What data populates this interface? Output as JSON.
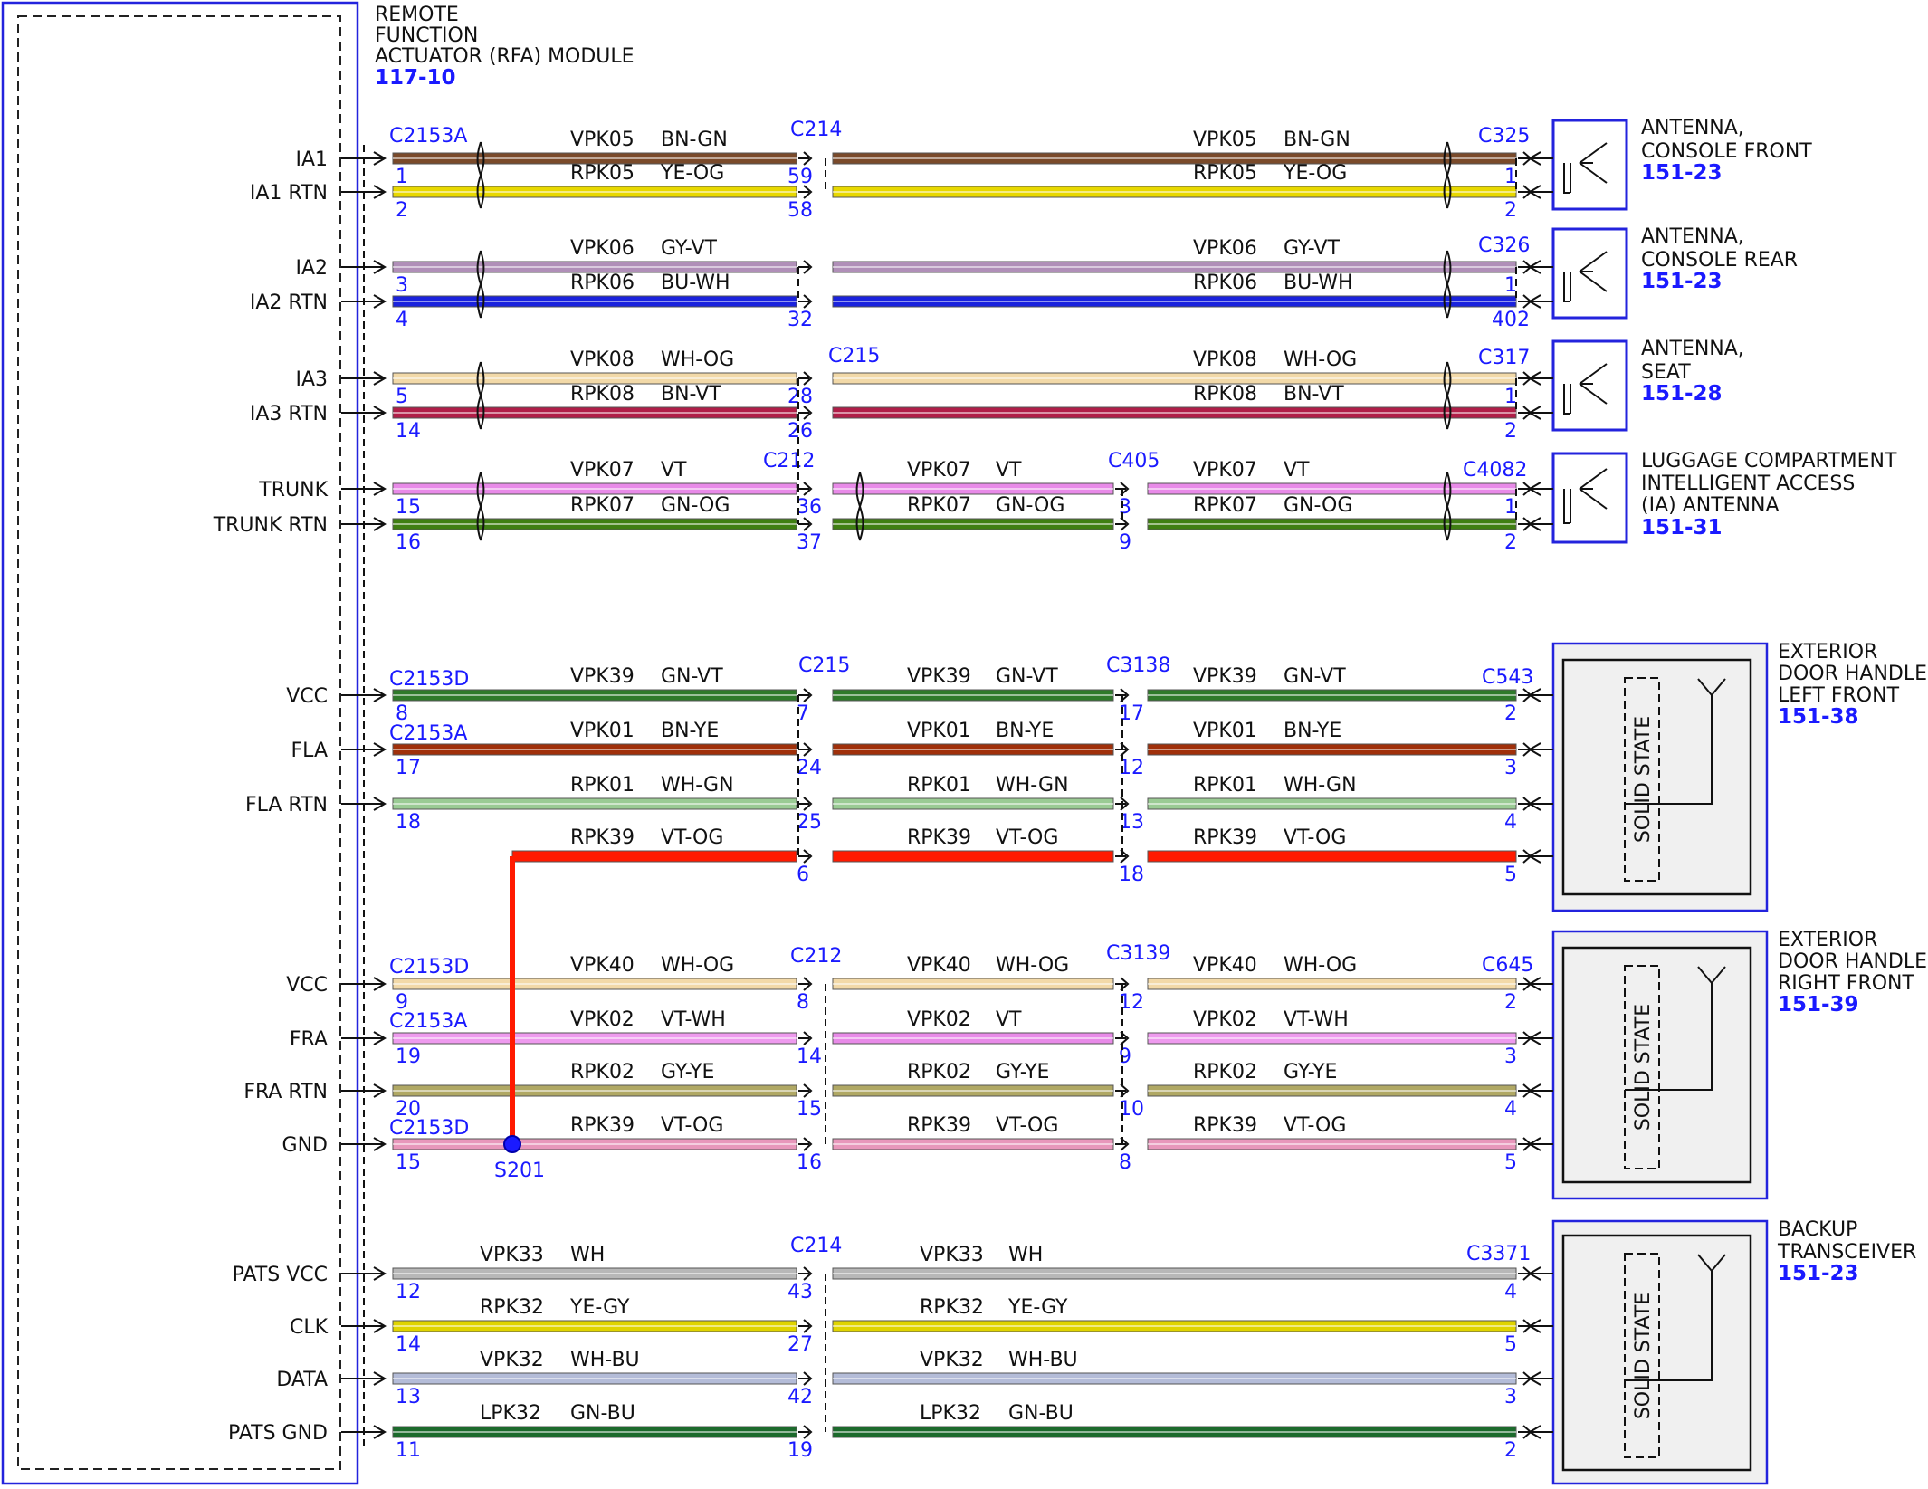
{
  "module": {
    "title_lines": [
      "REMOTE",
      "FUNCTION",
      "ACTUATOR (RFA) MODULE"
    ],
    "ref": "117-10"
  },
  "components": [
    {
      "lines": [
        "ANTENNA,",
        "CONSOLE FRONT"
      ],
      "ref": "151-23"
    },
    {
      "lines": [
        "ANTENNA,",
        "CONSOLE REAR"
      ],
      "ref": "151-23"
    },
    {
      "lines": [
        "ANTENNA,",
        "SEAT"
      ],
      "ref": "151-28"
    },
    {
      "lines": [
        "LUGGAGE COMPARTMENT",
        "INTELLIGENT ACCESS",
        "(IA) ANTENNA"
      ],
      "ref": "151-31"
    },
    {
      "lines": [
        "EXTERIOR",
        "DOOR HANDLE,",
        "LEFT FRONT"
      ],
      "ref": "151-38"
    },
    {
      "lines": [
        "EXTERIOR",
        "DOOR HANDLE,",
        "RIGHT FRONT"
      ],
      "ref": "151-39"
    },
    {
      "lines": [
        "BACKUP",
        "TRANSCEIVER"
      ],
      "ref": "151-23"
    }
  ],
  "solid_state_label": "SOLID STATE",
  "splice": "S201",
  "colors": {
    "BN-GN": "#7a4a2a",
    "YE-OG": "#e8d800",
    "GY-VT": "#b08fb8",
    "BU-WH": "#1a22dd",
    "WH-OG": "#f2d9a8",
    "BN-VT": "#b01e48",
    "VT": "#e88ae8",
    "GN-OG": "#3f7f12",
    "GN-VT": "#2f7a2a",
    "BN-YE": "#a0300a",
    "WH-GN": "#9acb94",
    "VT-OG": "#ff1a00",
    "VT-WH": "#ee9aee",
    "GY-YE": "#b0a864",
    "WH": "#b8b8b8",
    "YE-GY": "#e0d400",
    "WH-BU": "#b4bcd8",
    "GN-BU": "#1c6a2c",
    "GND": "#e897bb"
  },
  "wires": [
    {
      "sig": "IA1",
      "seg": [
        {
          "c": "VPK05",
          "col": "BN-GN"
        },
        {
          "c": "VPK05",
          "col": "BN-GN"
        }
      ],
      "pins": [
        "1",
        "59",
        "1"
      ]
    },
    {
      "sig": "IA1 RTN",
      "seg": [
        {
          "c": "RPK05",
          "col": "YE-OG"
        },
        {
          "c": "RPK05",
          "col": "YE-OG"
        }
      ],
      "pins": [
        "2",
        "58",
        "2"
      ]
    },
    {
      "sig": "IA2",
      "seg": [
        {
          "c": "VPK06",
          "col": "GY-VT"
        },
        {
          "c": "VPK06",
          "col": "GY-VT"
        }
      ],
      "pins": [
        "3",
        "",
        "1"
      ]
    },
    {
      "sig": "IA2 RTN",
      "seg": [
        {
          "c": "RPK06",
          "col": "BU-WH"
        },
        {
          "c": "RPK06",
          "col": "BU-WH"
        }
      ],
      "pins": [
        "4",
        "32",
        "40",
        "2"
      ]
    },
    {
      "sig": "IA3",
      "seg": [
        {
          "c": "VPK08",
          "col": "WH-OG"
        },
        {
          "c": "VPK08",
          "col": "WH-OG"
        }
      ],
      "pins": [
        "5",
        "28",
        "1"
      ]
    },
    {
      "sig": "IA3 RTN",
      "seg": [
        {
          "c": "RPK08",
          "col": "BN-VT"
        },
        {
          "c": "RPK08",
          "col": "BN-VT"
        }
      ],
      "pins": [
        "14",
        "26",
        "2"
      ]
    },
    {
      "sig": "TRUNK",
      "seg": [
        {
          "c": "VPK07",
          "col": "VT"
        },
        {
          "c": "VPK07",
          "col": "VT"
        },
        {
          "c": "VPK07",
          "col": "VT"
        }
      ],
      "pins": [
        "15",
        "36",
        "3",
        "1"
      ]
    },
    {
      "sig": "TRUNK RTN",
      "seg": [
        {
          "c": "RPK07",
          "col": "GN-OG"
        },
        {
          "c": "RPK07",
          "col": "GN-OG"
        },
        {
          "c": "RPK07",
          "col": "GN-OG"
        }
      ],
      "pins": [
        "16",
        "37",
        "9",
        "2"
      ]
    },
    {
      "sig": "VCC",
      "seg": [
        {
          "c": "VPK39",
          "col": "GN-VT"
        },
        {
          "c": "VPK39",
          "col": "GN-VT"
        },
        {
          "c": "VPK39",
          "col": "GN-VT"
        }
      ],
      "pins": [
        "8",
        "7",
        "17",
        "2"
      ]
    },
    {
      "sig": "FLA",
      "seg": [
        {
          "c": "VPK01",
          "col": "BN-YE"
        },
        {
          "c": "VPK01",
          "col": "BN-YE"
        },
        {
          "c": "VPK01",
          "col": "BN-YE"
        }
      ],
      "pins": [
        "17",
        "24",
        "12",
        "3"
      ]
    },
    {
      "sig": "FLA RTN",
      "seg": [
        {
          "c": "RPK01",
          "col": "WH-GN"
        },
        {
          "c": "RPK01",
          "col": "WH-GN"
        },
        {
          "c": "RPK01",
          "col": "WH-GN"
        }
      ],
      "pins": [
        "18",
        "25",
        "13",
        "4"
      ]
    },
    {
      "sig": "",
      "seg": [
        {
          "c": "RPK39",
          "col": "VT-OG"
        },
        {
          "c": "RPK39",
          "col": "VT-OG"
        },
        {
          "c": "RPK39",
          "col": "VT-OG"
        }
      ],
      "pins": [
        "",
        "6",
        "18",
        "5"
      ]
    },
    {
      "sig": "VCC",
      "seg": [
        {
          "c": "VPK40",
          "col": "WH-OG"
        },
        {
          "c": "VPK40",
          "col": "WH-OG"
        },
        {
          "c": "VPK40",
          "col": "WH-OG"
        }
      ],
      "pins": [
        "9",
        "8",
        "12",
        "2"
      ]
    },
    {
      "sig": "FRA",
      "seg": [
        {
          "c": "VPK02",
          "col": "VT-WH"
        },
        {
          "c": "VPK02",
          "col": "VT"
        },
        {
          "c": "VPK02",
          "col": "VT-WH"
        }
      ],
      "pins": [
        "19",
        "14",
        "9",
        "3"
      ]
    },
    {
      "sig": "FRA RTN",
      "seg": [
        {
          "c": "RPK02",
          "col": "GY-YE"
        },
        {
          "c": "RPK02",
          "col": "GY-YE"
        },
        {
          "c": "RPK02",
          "col": "GY-YE"
        }
      ],
      "pins": [
        "20",
        "15",
        "10",
        "4"
      ]
    },
    {
      "sig": "GND",
      "seg": [
        {
          "c": "RPK39",
          "col": "VT-OG"
        },
        {
          "c": "RPK39",
          "col": "VT-OG"
        },
        {
          "c": "RPK39",
          "col": "VT-OG"
        }
      ],
      "pins": [
        "15",
        "16",
        "8",
        "5"
      ]
    },
    {
      "sig": "PATS VCC",
      "seg": [
        {
          "c": "VPK33",
          "col": "WH"
        },
        {
          "c": "VPK33",
          "col": "WH"
        }
      ],
      "pins": [
        "12",
        "43",
        "4"
      ]
    },
    {
      "sig": "CLK",
      "seg": [
        {
          "c": "RPK32",
          "col": "YE-GY"
        },
        {
          "c": "RPK32",
          "col": "YE-GY"
        }
      ],
      "pins": [
        "14",
        "27",
        "5"
      ]
    },
    {
      "sig": "DATA",
      "seg": [
        {
          "c": "VPK32",
          "col": "WH-BU"
        },
        {
          "c": "VPK32",
          "col": "WH-BU"
        }
      ],
      "pins": [
        "13",
        "42",
        "3"
      ]
    },
    {
      "sig": "PATS GND",
      "seg": [
        {
          "c": "LPK32",
          "col": "GN-BU"
        },
        {
          "c": "LPK32",
          "col": "GN-BU"
        }
      ],
      "pins": [
        "11",
        "19",
        "2"
      ]
    }
  ],
  "connectors": [
    "C2153A",
    "C214",
    "C325",
    "C326",
    "C215",
    "C317",
    "C212",
    "C405",
    "C4082",
    "C2153D",
    "C3138",
    "C543",
    "C3139",
    "C645",
    "C3371"
  ]
}
